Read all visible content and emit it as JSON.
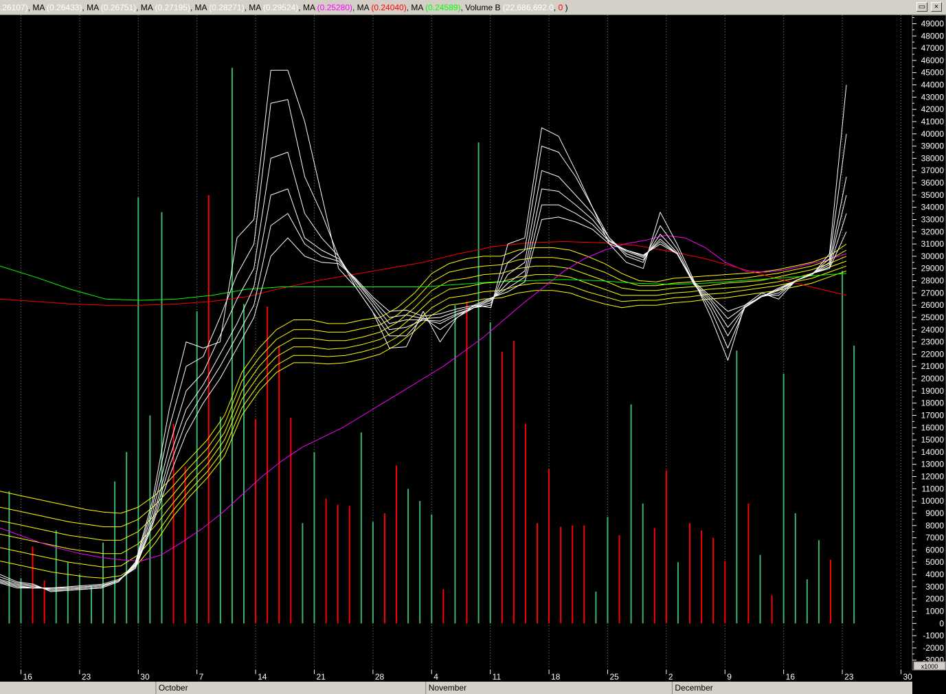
{
  "legend": [
    {
      "text": ".26107)",
      "color": "#ffffff"
    },
    {
      "text": ", MA ",
      "color": "#000000"
    },
    {
      "text": "(0.26433)",
      "color": "#ffffff"
    },
    {
      "text": ", MA ",
      "color": "#000000"
    },
    {
      "text": "(0.26751)",
      "color": "#ffffff"
    },
    {
      "text": ", MA ",
      "color": "#000000"
    },
    {
      "text": "(0.27195)",
      "color": "#ffffff"
    },
    {
      "text": ", MA ",
      "color": "#000000"
    },
    {
      "text": "(0.28271)",
      "color": "#ffffff"
    },
    {
      "text": ", MA ",
      "color": "#000000"
    },
    {
      "text": "(0.29524)",
      "color": "#ffffff"
    },
    {
      "text": ", MA ",
      "color": "#000000"
    },
    {
      "text": "(0.25280)",
      "color": "#ff00ff"
    },
    {
      "text": ", MA ",
      "color": "#000000"
    },
    {
      "text": "(0.24040)",
      "color": "#ff0000"
    },
    {
      "text": ", MA ",
      "color": "#000000"
    },
    {
      "text": "(0.24589)",
      "color": "#00ff00"
    },
    {
      "text": ", Volume B ",
      "color": "#000000"
    },
    {
      "text": "(22,686,692.0",
      "color": "#ffffff"
    },
    {
      "text": ", ",
      "color": "#000000"
    },
    {
      "text": "0",
      "color": "#ff0000"
    },
    {
      "text": " )",
      "color": "#000000"
    }
  ],
  "window_buttons": {
    "restore": "▭",
    "close": "×"
  },
  "chart_data": {
    "type": "bar",
    "y_ticks": [
      -3000,
      -2000,
      -1000,
      0,
      1000,
      2000,
      3000,
      4000,
      5000,
      6000,
      7000,
      8000,
      9000,
      10000,
      11000,
      12000,
      13000,
      14000,
      15000,
      16000,
      17000,
      18000,
      19000,
      20000,
      21000,
      22000,
      23000,
      24000,
      25000,
      26000,
      27000,
      28000,
      29000,
      30000,
      31000,
      32000,
      33000,
      34000,
      35000,
      36000,
      37000,
      38000,
      39000,
      40000,
      41000,
      42000,
      43000,
      44000,
      45000,
      46000,
      47000,
      48000,
      49000
    ],
    "y_labels": [
      "-3000",
      "-2000",
      "-1000",
      "0",
      "1000",
      "2000",
      "3000",
      "4000",
      "5000",
      "6000",
      "7000",
      "8000",
      "9000",
      "10000",
      "11000",
      "12000",
      "13000",
      "14000",
      "15000",
      "16000",
      "17000",
      "18000",
      "19000",
      "20000",
      "21000",
      "22000",
      "23000",
      "24000",
      "25000",
      "26000",
      "27000",
      "28000",
      "29000",
      "30000",
      "31000",
      "32000",
      "33000",
      "34000",
      "35000",
      "36000",
      "37000",
      "38000",
      "39000",
      "40000",
      "41000",
      "42000",
      "43000",
      "44000",
      "45000",
      "46000",
      "47000",
      "48000",
      "49000"
    ],
    "ylim": [
      -3800,
      49700
    ],
    "y_multiplier": "x1000",
    "date_ticks": [
      {
        "label": "16",
        "bar": 1
      },
      {
        "label": "23",
        "bar": 6
      },
      {
        "label": "30",
        "bar": 11
      },
      {
        "label": "7",
        "bar": 16
      },
      {
        "label": "14",
        "bar": 21
      },
      {
        "label": "21",
        "bar": 26
      },
      {
        "label": "28",
        "bar": 31
      },
      {
        "label": "4",
        "bar": 36
      },
      {
        "label": "11",
        "bar": 41
      },
      {
        "label": "18",
        "bar": 46
      },
      {
        "label": "25",
        "bar": 51
      },
      {
        "label": "2",
        "bar": 56
      },
      {
        "label": "9",
        "bar": 61
      },
      {
        "label": "16",
        "bar": 66
      },
      {
        "label": "23",
        "bar": 71
      },
      {
        "label": "30",
        "bar": 76
      }
    ],
    "months": [
      {
        "label": "October",
        "bar": 12.5
      },
      {
        "label": "November",
        "bar": 35.5
      },
      {
        "label": "December",
        "bar": 56.5
      }
    ],
    "volume": {
      "colors": {
        "up": "#3cb371",
        "down": "#ff0000"
      },
      "values": [
        10800,
        3700,
        6300,
        3500,
        7600,
        5000,
        4000,
        3000,
        6600,
        11600,
        14000,
        34800,
        17000,
        33600,
        16300,
        12800,
        25500,
        35000,
        16900,
        45400,
        26100,
        16700,
        25900,
        22700,
        16800,
        8200,
        14000,
        10200,
        9700,
        9600,
        15600,
        8300,
        9000,
        12900,
        11000,
        10000,
        8900,
        2800,
        26000,
        26300,
        39300,
        24600,
        22200,
        23100,
        16300,
        8200,
        12600,
        7900,
        8000,
        8000,
        2600,
        8700,
        7200,
        17900,
        9800,
        7800,
        12500,
        5000,
        8200,
        7600,
        7000,
        5100,
        22300,
        9800,
        5600,
        2300,
        20400,
        9000,
        3600,
        6800,
        5200,
        28800,
        22700
      ],
      "up": [
        1,
        1,
        0,
        0,
        1,
        1,
        1,
        1,
        1,
        1,
        1,
        1,
        1,
        1,
        0,
        0,
        1,
        0,
        1,
        1,
        1,
        0,
        0,
        0,
        0,
        1,
        1,
        0,
        0,
        0,
        1,
        1,
        0,
        0,
        1,
        1,
        1,
        0,
        1,
        0,
        1,
        1,
        0,
        0,
        0,
        0,
        0,
        0,
        0,
        0,
        1,
        1,
        0,
        1,
        1,
        0,
        0,
        1,
        0,
        0,
        0,
        0,
        1,
        0,
        1,
        0,
        1,
        1,
        1,
        1,
        0,
        1,
        1
      ]
    },
    "series": [
      {
        "color": "#ffffff",
        "values": [
          4000,
          3400,
          3200,
          2600,
          2700,
          2800,
          2900,
          3400,
          5000,
          10000,
          17500,
          23000,
          22500,
          23000,
          31500,
          33000,
          45200,
          45200,
          41000,
          35000,
          29000,
          27500,
          25500,
          22500,
          22600,
          25500,
          23000,
          25000,
          26000,
          25800,
          31000,
          31500,
          40500,
          39800,
          37000,
          34000,
          31000,
          29500,
          29000,
          33600,
          31000,
          28000,
          25000,
          21500,
          26000,
          27000,
          26500,
          28000,
          28500,
          30200,
          44000
        ]
      },
      {
        "color": "#ffffff",
        "values": [
          3800,
          3300,
          3100,
          2700,
          2700,
          2800,
          2900,
          3400,
          4900,
          9500,
          16000,
          21000,
          21800,
          25000,
          28500,
          31000,
          42500,
          42800,
          36500,
          33500,
          30000,
          27500,
          25500,
          23500,
          23500,
          25000,
          24000,
          25000,
          25800,
          26000,
          29500,
          30500,
          39000,
          38500,
          36500,
          34000,
          31500,
          30000,
          29500,
          32500,
          30600,
          27800,
          25600,
          22500,
          25800,
          26800,
          26800,
          28000,
          28600,
          29800,
          40000
        ]
      },
      {
        "color": "#ffffff",
        "values": [
          3600,
          3200,
          3000,
          2800,
          2800,
          2900,
          3000,
          3500,
          4800,
          9000,
          14500,
          19000,
          20500,
          23500,
          26500,
          29000,
          38000,
          38500,
          33500,
          31500,
          30000,
          27800,
          26000,
          24000,
          24200,
          24800,
          24500,
          25200,
          25800,
          26200,
          28500,
          29500,
          37000,
          36500,
          35000,
          33500,
          31500,
          30200,
          29700,
          31800,
          30300,
          27700,
          26000,
          23500,
          25800,
          26700,
          27000,
          28000,
          28600,
          29500,
          36500
        ]
      },
      {
        "color": "#ffffff",
        "values": [
          3500,
          3100,
          2900,
          2900,
          2900,
          3000,
          3100,
          3500,
          4700,
          8500,
          13500,
          17500,
          19500,
          22000,
          24500,
          27500,
          35000,
          35500,
          31500,
          30500,
          29800,
          28000,
          26300,
          24500,
          24800,
          24800,
          24700,
          25300,
          25800,
          26400,
          27800,
          28800,
          35500,
          35300,
          34200,
          33000,
          31300,
          30400,
          29900,
          31400,
          30200,
          27700,
          26300,
          24200,
          25800,
          26700,
          27200,
          28000,
          28600,
          29300,
          35000
        ]
      },
      {
        "color": "#ffffff",
        "values": [
          3400,
          3000,
          2900,
          2900,
          2900,
          3000,
          3100,
          3500,
          4600,
          8200,
          12800,
          16500,
          18800,
          21000,
          23500,
          26000,
          32500,
          33500,
          31000,
          30000,
          29600,
          28100,
          26500,
          25000,
          25200,
          24900,
          25000,
          25500,
          25900,
          26500,
          27400,
          28300,
          34200,
          34200,
          33500,
          32600,
          31200,
          30500,
          30000,
          31200,
          30200,
          27800,
          26500,
          24900,
          25900,
          26700,
          27300,
          28000,
          28600,
          29100,
          33500
        ]
      },
      {
        "color": "#ffffff",
        "values": [
          3300,
          2900,
          2900,
          2900,
          3000,
          3100,
          3200,
          3600,
          4500,
          8000,
          12000,
          15500,
          18000,
          20000,
          22500,
          25000,
          30000,
          31500,
          30000,
          29500,
          29400,
          28200,
          26700,
          25500,
          25600,
          25100,
          25300,
          25700,
          26000,
          26600,
          27100,
          27900,
          33000,
          33200,
          32800,
          32200,
          31000,
          30500,
          30100,
          31000,
          30200,
          27900,
          26700,
          25500,
          26000,
          26700,
          27400,
          28000,
          28600,
          29000,
          32000
        ]
      },
      {
        "color": "#ffff00",
        "values": [
          10800,
          10500,
          10200,
          9900,
          9600,
          9300,
          9100,
          9000,
          9500,
          10500,
          12000,
          13500,
          15000,
          17000,
          20500,
          22500,
          24000,
          24800,
          24800,
          24500,
          24500,
          24800,
          25000,
          25800,
          27000,
          28600,
          29400,
          29800,
          30000,
          30000,
          30500,
          30700,
          30700,
          30500,
          30000,
          29400,
          28600,
          28000,
          27900,
          28200,
          28300,
          28400,
          28500,
          28600,
          28700,
          28900,
          29200,
          29500,
          30000,
          31000
        ]
      },
      {
        "color": "#ffff00",
        "values": [
          9500,
          9200,
          8900,
          8600,
          8300,
          8100,
          7900,
          7900,
          8500,
          9700,
          11200,
          12800,
          14300,
          16300,
          19800,
          21700,
          23200,
          24000,
          24000,
          23800,
          23800,
          24100,
          24400,
          25200,
          26400,
          27900,
          28700,
          29000,
          29200,
          29300,
          29700,
          29900,
          29900,
          29700,
          29200,
          28700,
          28000,
          27600,
          27600,
          27800,
          27900,
          28000,
          28100,
          28200,
          28400,
          28600,
          28900,
          29200,
          29700,
          30500
        ]
      },
      {
        "color": "#ffff00",
        "values": [
          8400,
          8100,
          7800,
          7500,
          7200,
          7000,
          6800,
          6800,
          7500,
          8900,
          10500,
          12200,
          13600,
          15600,
          19000,
          21000,
          22500,
          23300,
          23300,
          23100,
          23100,
          23400,
          23800,
          24600,
          25800,
          27200,
          28000,
          28200,
          28500,
          28600,
          29000,
          29200,
          29200,
          29000,
          28500,
          28000,
          27400,
          27200,
          27200,
          27400,
          27500,
          27600,
          27800,
          27900,
          28000,
          28300,
          28600,
          28900,
          29400,
          30000
        ]
      },
      {
        "color": "#ffff00",
        "values": [
          7300,
          7000,
          6700,
          6400,
          6100,
          5900,
          5700,
          5700,
          6500,
          8000,
          9800,
          11500,
          13000,
          15000,
          18300,
          20300,
          21800,
          22600,
          22600,
          22400,
          22500,
          22800,
          23200,
          24000,
          25200,
          26500,
          27300,
          27500,
          27800,
          27900,
          28300,
          28500,
          28500,
          28300,
          27800,
          27300,
          26800,
          26800,
          26800,
          27000,
          27100,
          27300,
          27400,
          27500,
          27700,
          27900,
          28200,
          28600,
          29100,
          29600
        ]
      },
      {
        "color": "#ffff00",
        "values": [
          6200,
          5900,
          5600,
          5300,
          5000,
          4800,
          4600,
          4700,
          5600,
          7200,
          9200,
          10900,
          12400,
          14300,
          17600,
          19600,
          21100,
          21900,
          21900,
          21800,
          21900,
          22200,
          22600,
          23400,
          24500,
          25800,
          26600,
          26800,
          27100,
          27200,
          27600,
          27800,
          27800,
          27600,
          27100,
          26700,
          26300,
          26400,
          26400,
          26600,
          26700,
          26900,
          27000,
          27200,
          27400,
          27600,
          27900,
          28200,
          28700,
          29200
        ]
      },
      {
        "color": "#ffff00",
        "values": [
          5100,
          4800,
          4500,
          4200,
          4000,
          3800,
          3700,
          3900,
          4900,
          6600,
          8700,
          10400,
          11900,
          13700,
          17000,
          19000,
          20500,
          21300,
          21300,
          21200,
          21300,
          21600,
          22000,
          22800,
          23900,
          25200,
          26000,
          26200,
          26500,
          26600,
          27000,
          27200,
          27200,
          27000,
          26500,
          26100,
          25800,
          26000,
          26000,
          26200,
          26300,
          26500,
          26600,
          26800,
          27000,
          27200,
          27500,
          27800,
          28300,
          28800
        ]
      },
      {
        "color": "#ff00ff",
        "values": [
          7800,
          7200,
          6600,
          6100,
          5700,
          5400,
          5200,
          5100,
          5600,
          6600,
          7700,
          9000,
          10500,
          12000,
          13300,
          14400,
          15200,
          16000,
          17000,
          18000,
          19000,
          20000,
          21000,
          22200,
          23400,
          24800,
          26200,
          27500,
          28800,
          29800,
          30500,
          31000,
          31300,
          31700,
          31500,
          30700,
          29500,
          28800,
          28700,
          28900,
          29300,
          29700,
          30200
        ]
      },
      {
        "color": "#ff0000",
        "values": [
          26500,
          26300,
          26100,
          26000,
          26000,
          26100,
          26300,
          26700,
          27400,
          28000,
          28500,
          29000,
          29500,
          30200,
          30800,
          31100,
          31200,
          31100,
          30900,
          30400,
          29800,
          29000,
          28200,
          27500,
          26800
        ]
      },
      {
        "color": "#00ff00",
        "values": [
          29200,
          28300,
          27300,
          26500,
          26400,
          26500,
          26800,
          27300,
          27500,
          27500,
          27500,
          27500,
          27500,
          27700,
          27900,
          28000,
          28100,
          28000,
          27800,
          27700,
          27800,
          28000,
          28200,
          28400,
          28600
        ]
      }
    ],
    "grid": true
  }
}
